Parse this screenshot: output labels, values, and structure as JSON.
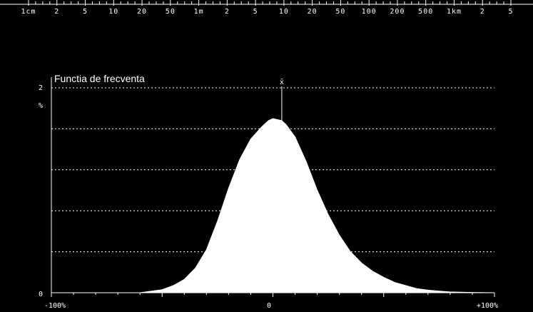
{
  "top_scale": {
    "labels": [
      "1cm",
      "2",
      "5",
      "10",
      "20",
      "50",
      "1m",
      "2",
      "5",
      "10",
      "20",
      "50",
      "100",
      "200",
      "500",
      "1km",
      "2",
      "5"
    ]
  },
  "chart_data": {
    "type": "area",
    "title": "Functia de frecventa",
    "ylabel": "%",
    "y_tick_labels": [
      "2",
      "0"
    ],
    "x_tick_labels": [
      "-100%",
      "0",
      "+100%"
    ],
    "mean_marker_label": "x̄",
    "xlim": [
      -100,
      100
    ],
    "ylim": [
      0,
      2
    ],
    "grid": true,
    "mean_x": 4,
    "x": [
      -100,
      -60,
      -50,
      -45,
      -40,
      -35,
      -30,
      -25,
      -20,
      -15,
      -10,
      -5,
      -2,
      0,
      2,
      4,
      6,
      10,
      15,
      20,
      25,
      30,
      35,
      40,
      45,
      50,
      55,
      60,
      65,
      70,
      75,
      80,
      90,
      100
    ],
    "values": [
      0,
      0,
      0.03,
      0.07,
      0.13,
      0.24,
      0.42,
      0.7,
      1.02,
      1.3,
      1.5,
      1.62,
      1.68,
      1.7,
      1.69,
      1.68,
      1.64,
      1.52,
      1.28,
      1.0,
      0.76,
      0.56,
      0.4,
      0.29,
      0.21,
      0.15,
      0.1,
      0.07,
      0.04,
      0.025,
      0.015,
      0.008,
      0.003,
      0
    ]
  }
}
